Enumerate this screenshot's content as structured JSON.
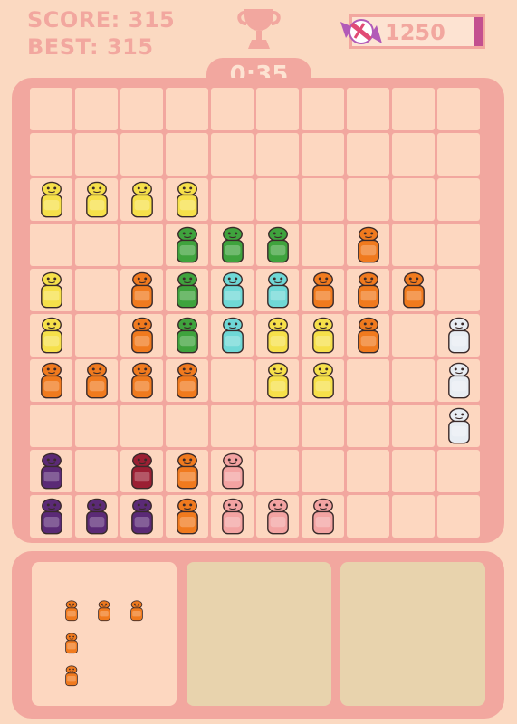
{
  "hud": {
    "score_text": "SCORE: 315",
    "best_text": "BEST: 315",
    "coins": "1250",
    "timer": "0:35"
  },
  "colors": {
    "background": "#fbd9c1",
    "frame": "#f2a79f",
    "cell": "#fdd7c0",
    "empty_slot": "#e8d3ad",
    "candy_bar": "#c3508f"
  },
  "board": {
    "rows": 10,
    "cols": 10,
    "pieces": [
      {
        "r": 2,
        "c": 0,
        "color": "yellow"
      },
      {
        "r": 2,
        "c": 1,
        "color": "yellow"
      },
      {
        "r": 2,
        "c": 2,
        "color": "yellow"
      },
      {
        "r": 2,
        "c": 3,
        "color": "yellow"
      },
      {
        "r": 3,
        "c": 3,
        "color": "green"
      },
      {
        "r": 3,
        "c": 4,
        "color": "green"
      },
      {
        "r": 3,
        "c": 5,
        "color": "green"
      },
      {
        "r": 3,
        "c": 7,
        "color": "orange"
      },
      {
        "r": 4,
        "c": 0,
        "color": "yellow"
      },
      {
        "r": 4,
        "c": 2,
        "color": "orange"
      },
      {
        "r": 4,
        "c": 3,
        "color": "green"
      },
      {
        "r": 4,
        "c": 4,
        "color": "cyan"
      },
      {
        "r": 4,
        "c": 5,
        "color": "cyan"
      },
      {
        "r": 4,
        "c": 6,
        "color": "orange"
      },
      {
        "r": 4,
        "c": 7,
        "color": "orange"
      },
      {
        "r": 4,
        "c": 8,
        "color": "orange"
      },
      {
        "r": 5,
        "c": 0,
        "color": "yellow"
      },
      {
        "r": 5,
        "c": 2,
        "color": "orange"
      },
      {
        "r": 5,
        "c": 3,
        "color": "green"
      },
      {
        "r": 5,
        "c": 4,
        "color": "cyan"
      },
      {
        "r": 5,
        "c": 5,
        "color": "yellow"
      },
      {
        "r": 5,
        "c": 6,
        "color": "yellow"
      },
      {
        "r": 5,
        "c": 7,
        "color": "orange"
      },
      {
        "r": 5,
        "c": 9,
        "color": "white"
      },
      {
        "r": 6,
        "c": 0,
        "color": "orange"
      },
      {
        "r": 6,
        "c": 1,
        "color": "orange"
      },
      {
        "r": 6,
        "c": 2,
        "color": "orange"
      },
      {
        "r": 6,
        "c": 3,
        "color": "orange"
      },
      {
        "r": 6,
        "c": 5,
        "color": "yellow"
      },
      {
        "r": 6,
        "c": 6,
        "color": "yellow"
      },
      {
        "r": 6,
        "c": 9,
        "color": "white"
      },
      {
        "r": 7,
        "c": 9,
        "color": "white"
      },
      {
        "r": 8,
        "c": 0,
        "color": "purple"
      },
      {
        "r": 8,
        "c": 2,
        "color": "darkred"
      },
      {
        "r": 8,
        "c": 3,
        "color": "orange"
      },
      {
        "r": 8,
        "c": 4,
        "color": "pink"
      },
      {
        "r": 9,
        "c": 0,
        "color": "purple"
      },
      {
        "r": 9,
        "c": 1,
        "color": "purple"
      },
      {
        "r": 9,
        "c": 2,
        "color": "purple"
      },
      {
        "r": 9,
        "c": 3,
        "color": "orange"
      },
      {
        "r": 9,
        "c": 4,
        "color": "pink"
      },
      {
        "r": 9,
        "c": 5,
        "color": "pink"
      },
      {
        "r": 9,
        "c": 6,
        "color": "pink"
      }
    ]
  },
  "palette": {
    "yellow": "#f6e04a",
    "green": "#3fa33d",
    "orange": "#f07a1e",
    "cyan": "#6fd8d6",
    "white": "#e8edf3",
    "purple": "#5b2a76",
    "darkred": "#9b1f33",
    "pink": "#f3a3a2"
  },
  "tray": {
    "slots": [
      {
        "state": "active",
        "piece_color": "orange",
        "cells": [
          [
            0,
            0
          ],
          [
            0,
            1
          ],
          [
            0,
            2
          ],
          [
            1,
            0
          ],
          [
            2,
            0
          ]
        ]
      },
      {
        "state": "empty"
      },
      {
        "state": "empty"
      }
    ]
  }
}
